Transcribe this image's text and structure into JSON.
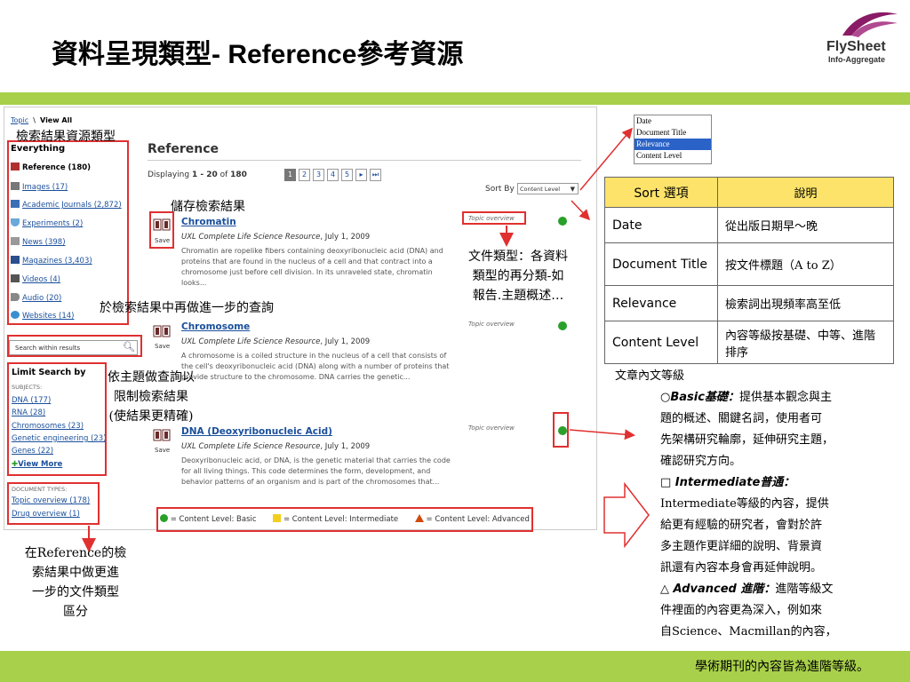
{
  "slide": {
    "title_cjk": "資料呈現類型",
    "title_latin": "- Reference",
    "title_cjk2": "參考資源",
    "logo_name": "FlySheet",
    "logo_tag": "Info-Aggregate",
    "footer_text": "學術期刊的內容皆為進階等級。"
  },
  "screenshot": {
    "breadcrumb_topic": "Topic",
    "breadcrumb_sep": "\\",
    "breadcrumb_view": "View All",
    "sidebar_title": "Everything",
    "sidebar_items": [
      {
        "label": "Reference (180)",
        "icon": "book-icon",
        "active": true
      },
      {
        "label": "Images (17)",
        "icon": "camera-icon"
      },
      {
        "label": "Academic Journals (2,872)",
        "icon": "journal-icon"
      },
      {
        "label": "Experiments (2)",
        "icon": "flask-icon"
      },
      {
        "label": "News (398)",
        "icon": "news-icon"
      },
      {
        "label": "Magazines (3,403)",
        "icon": "magazine-icon"
      },
      {
        "label": "Videos (4)",
        "icon": "video-icon"
      },
      {
        "label": "Audio (20)",
        "icon": "audio-icon"
      },
      {
        "label": "Websites (14)",
        "icon": "globe-icon"
      }
    ],
    "search_placeholder": "Search within results",
    "limit_title": "Limit Search by",
    "limit_subjects_label": "SUBJECTS:",
    "limit_subjects": [
      "DNA (177)",
      "RNA (28)",
      "Chromosomes (23)",
      "Genetic engineering (23)",
      "Genes (22)"
    ],
    "view_more": "View More",
    "doc_types_label": "DOCUMENT TYPES:",
    "doc_types": [
      "Topic overview (178)",
      "Drug overview (1)"
    ],
    "ref_heading": "Reference",
    "displaying_prefix": "Displaying ",
    "displaying_range": "1 - 20",
    "displaying_of": " of ",
    "displaying_total": "180",
    "pager": [
      "1",
      "2",
      "3",
      "4",
      "5",
      "▸",
      "⏭"
    ],
    "sort_by_label": "Sort By",
    "sort_by_value": "Content Level",
    "save_label": "Save",
    "results": [
      {
        "title": "Chromatin",
        "source": "UXL Complete Life Science Resource",
        "date": ", July 1, 2009",
        "body": "Chromatin are ropelike fibers containing deoxyribonucleic acid (DNA) and proteins that are found in the nucleus of a cell and that contract into a chromosome just before cell division. In its unraveled state, chromatin looks...",
        "doc_type": "Topic overview"
      },
      {
        "title": "Chromosome",
        "source": "UXL Complete Life Science Resource",
        "date": ", July 1, 2009",
        "body": "A chromosome is a coiled structure in the nucleus of a cell that consists of the cell's deoxyribonucleic acid (DNA) along with a number of proteins that provide structure to the chromosome. DNA carries the genetic...",
        "doc_type": "Topic overview"
      },
      {
        "title": "DNA (Deoxyribonucleic Acid)",
        "source": "UXL Complete Life Science Resource",
        "date": ", July 1, 2009",
        "body": "Deoxyribonucleic acid, or DNA, is the genetic material that carries the code for all living things. This code determines the form, development, and behavior patterns of an organism and is part of the chromosomes that...",
        "doc_type": "Topic overview"
      }
    ],
    "legend": [
      "= Content Level: Basic",
      "= Content Level: Intermediate",
      "= Content Level: Advanced"
    ]
  },
  "annotations": {
    "result_types": "檢索結果資源類型",
    "save_results": "儲存檢索結果",
    "doc_type_note": [
      "文件類型：各資料",
      "類型的再分類-如",
      "報告.主題概述…"
    ],
    "search_within": "於檢索結果中再做進一步的查詢",
    "limit_note": [
      "依主題做查詢以",
      "限制檢索結果",
      "(使結果更精確)"
    ],
    "reference_note_1": "在Reference的檢",
    "reference_note_2": "索結果中做更進",
    "reference_note_3": "一步的文件類型",
    "reference_note_4": "區分"
  },
  "sort_dropdown": [
    "Date",
    "Document Title",
    "Relevance",
    "Content Level"
  ],
  "sort_table": {
    "header": [
      "Sort 選項",
      "說明"
    ],
    "rows": [
      [
        "Date",
        "從出版日期早～晚"
      ],
      [
        "Document Title",
        "按文件標題（A to Z）"
      ],
      [
        "Relevance",
        "檢索詞出現頻率高至低"
      ],
      [
        "Content Level",
        "內容等級按基礎、中等、進階排序"
      ]
    ]
  },
  "levels": {
    "heading": "文章內文等級",
    "basic_title": "○Basic基礎：",
    "basic_text": [
      "提供基本觀念與主",
      "題的概述、關鍵名詞，使用者可",
      "先架構研究輪廓，延伸研究主題，",
      "確認研究方向。"
    ],
    "inter_title": "□ Intermediate普通：",
    "inter_text": [
      "Intermediate等級的內容，提供",
      "給更有經驗的研究者，會對於許",
      "多主題作更詳細的說明、背景資",
      "訊還有內容本身會再延伸說明。"
    ],
    "adv_title": "△ Advanced 進階：",
    "adv_text": [
      "進階等級文",
      "件裡面的內容更為深入，例如來",
      "自Science、Macmillan的內容，"
    ]
  }
}
